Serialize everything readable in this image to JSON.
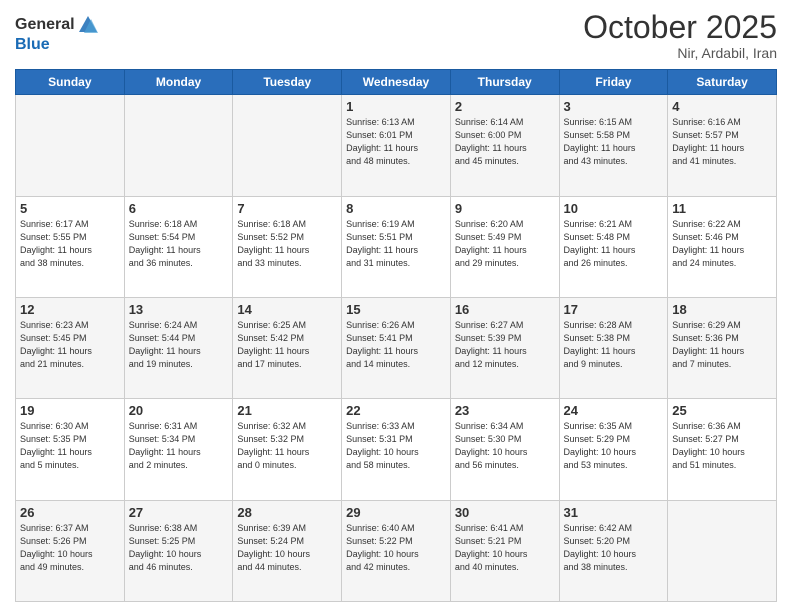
{
  "header": {
    "logo_general": "General",
    "logo_blue": "Blue",
    "month_title": "October 2025",
    "location": "Nir, Ardabil, Iran"
  },
  "calendar": {
    "days_of_week": [
      "Sunday",
      "Monday",
      "Tuesday",
      "Wednesday",
      "Thursday",
      "Friday",
      "Saturday"
    ],
    "weeks": [
      [
        {
          "day": "",
          "info": ""
        },
        {
          "day": "",
          "info": ""
        },
        {
          "day": "",
          "info": ""
        },
        {
          "day": "1",
          "info": "Sunrise: 6:13 AM\nSunset: 6:01 PM\nDaylight: 11 hours\nand 48 minutes."
        },
        {
          "day": "2",
          "info": "Sunrise: 6:14 AM\nSunset: 6:00 PM\nDaylight: 11 hours\nand 45 minutes."
        },
        {
          "day": "3",
          "info": "Sunrise: 6:15 AM\nSunset: 5:58 PM\nDaylight: 11 hours\nand 43 minutes."
        },
        {
          "day": "4",
          "info": "Sunrise: 6:16 AM\nSunset: 5:57 PM\nDaylight: 11 hours\nand 41 minutes."
        }
      ],
      [
        {
          "day": "5",
          "info": "Sunrise: 6:17 AM\nSunset: 5:55 PM\nDaylight: 11 hours\nand 38 minutes."
        },
        {
          "day": "6",
          "info": "Sunrise: 6:18 AM\nSunset: 5:54 PM\nDaylight: 11 hours\nand 36 minutes."
        },
        {
          "day": "7",
          "info": "Sunrise: 6:18 AM\nSunset: 5:52 PM\nDaylight: 11 hours\nand 33 minutes."
        },
        {
          "day": "8",
          "info": "Sunrise: 6:19 AM\nSunset: 5:51 PM\nDaylight: 11 hours\nand 31 minutes."
        },
        {
          "day": "9",
          "info": "Sunrise: 6:20 AM\nSunset: 5:49 PM\nDaylight: 11 hours\nand 29 minutes."
        },
        {
          "day": "10",
          "info": "Sunrise: 6:21 AM\nSunset: 5:48 PM\nDaylight: 11 hours\nand 26 minutes."
        },
        {
          "day": "11",
          "info": "Sunrise: 6:22 AM\nSunset: 5:46 PM\nDaylight: 11 hours\nand 24 minutes."
        }
      ],
      [
        {
          "day": "12",
          "info": "Sunrise: 6:23 AM\nSunset: 5:45 PM\nDaylight: 11 hours\nand 21 minutes."
        },
        {
          "day": "13",
          "info": "Sunrise: 6:24 AM\nSunset: 5:44 PM\nDaylight: 11 hours\nand 19 minutes."
        },
        {
          "day": "14",
          "info": "Sunrise: 6:25 AM\nSunset: 5:42 PM\nDaylight: 11 hours\nand 17 minutes."
        },
        {
          "day": "15",
          "info": "Sunrise: 6:26 AM\nSunset: 5:41 PM\nDaylight: 11 hours\nand 14 minutes."
        },
        {
          "day": "16",
          "info": "Sunrise: 6:27 AM\nSunset: 5:39 PM\nDaylight: 11 hours\nand 12 minutes."
        },
        {
          "day": "17",
          "info": "Sunrise: 6:28 AM\nSunset: 5:38 PM\nDaylight: 11 hours\nand 9 minutes."
        },
        {
          "day": "18",
          "info": "Sunrise: 6:29 AM\nSunset: 5:36 PM\nDaylight: 11 hours\nand 7 minutes."
        }
      ],
      [
        {
          "day": "19",
          "info": "Sunrise: 6:30 AM\nSunset: 5:35 PM\nDaylight: 11 hours\nand 5 minutes."
        },
        {
          "day": "20",
          "info": "Sunrise: 6:31 AM\nSunset: 5:34 PM\nDaylight: 11 hours\nand 2 minutes."
        },
        {
          "day": "21",
          "info": "Sunrise: 6:32 AM\nSunset: 5:32 PM\nDaylight: 11 hours\nand 0 minutes."
        },
        {
          "day": "22",
          "info": "Sunrise: 6:33 AM\nSunset: 5:31 PM\nDaylight: 10 hours\nand 58 minutes."
        },
        {
          "day": "23",
          "info": "Sunrise: 6:34 AM\nSunset: 5:30 PM\nDaylight: 10 hours\nand 56 minutes."
        },
        {
          "day": "24",
          "info": "Sunrise: 6:35 AM\nSunset: 5:29 PM\nDaylight: 10 hours\nand 53 minutes."
        },
        {
          "day": "25",
          "info": "Sunrise: 6:36 AM\nSunset: 5:27 PM\nDaylight: 10 hours\nand 51 minutes."
        }
      ],
      [
        {
          "day": "26",
          "info": "Sunrise: 6:37 AM\nSunset: 5:26 PM\nDaylight: 10 hours\nand 49 minutes."
        },
        {
          "day": "27",
          "info": "Sunrise: 6:38 AM\nSunset: 5:25 PM\nDaylight: 10 hours\nand 46 minutes."
        },
        {
          "day": "28",
          "info": "Sunrise: 6:39 AM\nSunset: 5:24 PM\nDaylight: 10 hours\nand 44 minutes."
        },
        {
          "day": "29",
          "info": "Sunrise: 6:40 AM\nSunset: 5:22 PM\nDaylight: 10 hours\nand 42 minutes."
        },
        {
          "day": "30",
          "info": "Sunrise: 6:41 AM\nSunset: 5:21 PM\nDaylight: 10 hours\nand 40 minutes."
        },
        {
          "day": "31",
          "info": "Sunrise: 6:42 AM\nSunset: 5:20 PM\nDaylight: 10 hours\nand 38 minutes."
        },
        {
          "day": "",
          "info": ""
        }
      ]
    ]
  }
}
